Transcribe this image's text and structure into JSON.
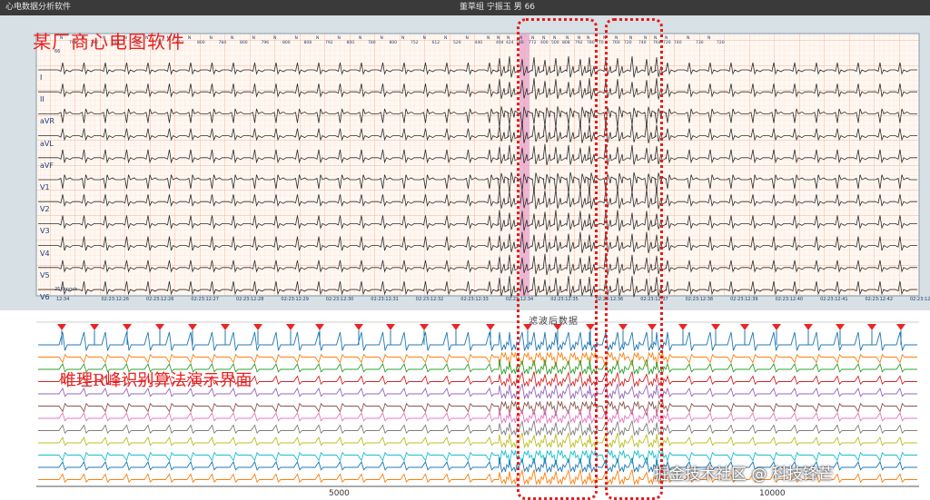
{
  "titlebar": {
    "app_title": "心电数据分析软件",
    "patient_info": "董草组 宁振玉   男   66"
  },
  "overlay": {
    "vendor_label": "某厂商心电图软件",
    "demo_label": "唯理R峰识别算法演示界面",
    "watermark": "掘金技术社区 @ 科技锋芒"
  },
  "ecg_panel": {
    "lead_names": [
      "I",
      "II",
      "aVR",
      "aVL",
      "aVF",
      "V1",
      "V2",
      "V3",
      "V4",
      "V5",
      "V6"
    ],
    "top_left_hr": "66",
    "scale_label": "25.0mm/s",
    "beat_intervals": [
      "796",
      "792",
      "784",
      "788",
      "776",
      "812",
      "800",
      "784",
      "800",
      "796",
      "800",
      "808",
      "792",
      "800",
      "780",
      "800",
      "752",
      "612",
      "520",
      "440",
      "404",
      "424",
      "760",
      "772",
      "400",
      "500",
      "808",
      "792",
      "780",
      "770",
      "760",
      "720",
      "740",
      "764",
      "720",
      "740",
      "730",
      "720"
    ],
    "time_labels": [
      "12:34",
      "02:23:12:26",
      "02:23:12:26",
      "02:23:12:27",
      "02:23:12:28",
      "02:23:12:29",
      "02:23:12:30",
      "02:23:12:31",
      "02:23:12:32",
      "02:23:12:33",
      "02:23:12:34",
      "02:23:12:35",
      "02:23:12:36",
      "02:23:12:37",
      "02:23:12:38",
      "02:23:12:39",
      "02:23:12:40",
      "02:23:12:41",
      "02:23:12:42",
      "02:23:12:43"
    ]
  },
  "filter_panel": {
    "title": "滤波后数据",
    "x_axis": {
      "tick_5000": "5000",
      "tick_10000": "10000"
    }
  },
  "colors": {
    "ecg_grid_major": "#f2a27c",
    "ecg_grid_minor": "#fbd9c6",
    "ecg_trace": "#2d2d2d",
    "highlight_band": "#e7a2c8",
    "r_peak_marker": "#e8262a",
    "highlight_box": "#e51a1a",
    "trace_palette": [
      "#1f77b4",
      "#ff7f0e",
      "#2ca02c",
      "#d62728",
      "#9467bd",
      "#8c564b",
      "#e377c2",
      "#7f7f7f",
      "#bcbd22",
      "#17becf",
      "#1f77b4",
      "#ff7f0e"
    ]
  }
}
